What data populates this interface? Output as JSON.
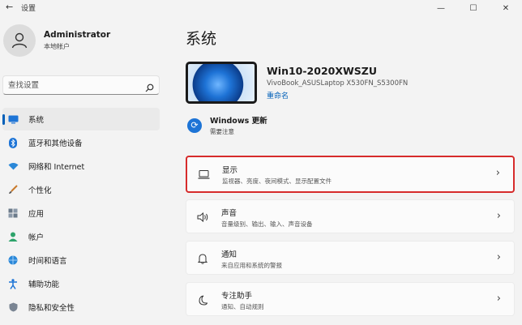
{
  "window": {
    "title": "设置",
    "controls": [
      "—",
      "☐",
      "✕"
    ]
  },
  "user": {
    "name": "Administrator",
    "account": "本地帐户"
  },
  "search": {
    "placeholder": "查找设置"
  },
  "nav": {
    "items": [
      {
        "label": "系统",
        "icon": "monitor-icon",
        "active": true
      },
      {
        "label": "蓝牙和其他设备",
        "icon": "bluetooth-icon"
      },
      {
        "label": "网络和 Internet",
        "icon": "wifi-icon"
      },
      {
        "label": "个性化",
        "icon": "brush-icon"
      },
      {
        "label": "应用",
        "icon": "apps-icon"
      },
      {
        "label": "帐户",
        "icon": "person-icon"
      },
      {
        "label": "时间和语言",
        "icon": "globe-clock-icon"
      },
      {
        "label": "辅助功能",
        "icon": "accessibility-icon"
      },
      {
        "label": "隐私和安全性",
        "icon": "shield-icon"
      }
    ]
  },
  "main": {
    "title": "系统",
    "device": {
      "name": "Win10-2020XWSZU",
      "model": "VivoBook_ASUSLaptop X530FN_S5300FN",
      "rename": "重命名"
    },
    "update": {
      "title": "Windows 更新",
      "status": "需要注意"
    },
    "cards": [
      {
        "title": "显示",
        "subtitle": "监视器、亮度、夜间模式、显示配置文件",
        "icon": "laptop-icon",
        "highlighted": true
      },
      {
        "title": "声音",
        "subtitle": "音量级别、输出、输入、声音设备",
        "icon": "speaker-icon"
      },
      {
        "title": "通知",
        "subtitle": "来自应用和系统的警报",
        "icon": "bell-icon"
      },
      {
        "title": "专注助手",
        "subtitle": "通知、自动规则",
        "icon": "moon-icon"
      }
    ]
  },
  "colors": {
    "accent": "#005fb8",
    "highlight_border": "#d62b2b",
    "background": "#f3f3f3"
  }
}
